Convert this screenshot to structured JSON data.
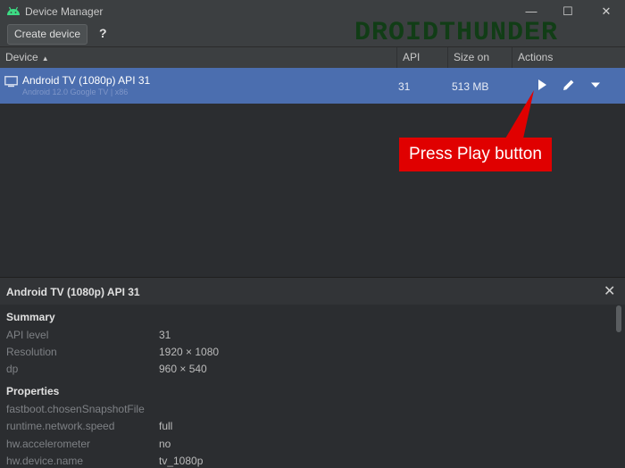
{
  "window": {
    "title": "Device Manager",
    "minimize_glyph": "—",
    "maximize_glyph": "☐",
    "close_glyph": "✕",
    "watermark": "DROIDTHUNDER"
  },
  "toolbar": {
    "create_label": "Create device",
    "help_label": "?"
  },
  "table": {
    "headers": {
      "device": "Device",
      "api": "API",
      "size": "Size on Disk",
      "actions": "Actions"
    },
    "rows": [
      {
        "name": "Android TV (1080p) API 31",
        "subtitle": "Android 12.0 Google TV | x86",
        "api": "31",
        "size": "513 MB",
        "action_icons": [
          "play-icon",
          "edit-pencil-icon",
          "dropdown-arrow-icon"
        ]
      }
    ]
  },
  "annotation": {
    "text": "Press Play button"
  },
  "details": {
    "title": "Android TV (1080p) API 31",
    "close_glyph": "✕",
    "summary": {
      "heading": "Summary",
      "items": [
        {
          "key": "API level",
          "value": "31"
        },
        {
          "key": "Resolution",
          "value": "1920 × 1080"
        },
        {
          "key": "dp",
          "value": "960 × 540"
        }
      ]
    },
    "properties": {
      "heading": "Properties",
      "items": [
        {
          "key": "fastboot.chosenSnapshotFile",
          "value": ""
        },
        {
          "key": "runtime.network.speed",
          "value": "full"
        },
        {
          "key": "hw.accelerometer",
          "value": "no"
        },
        {
          "key": "hw.device.name",
          "value": "tv_1080p"
        }
      ]
    }
  },
  "colors": {
    "selected_row": "#4b6eaf",
    "callout": "#e00000",
    "android_green": "#3ddc84"
  }
}
